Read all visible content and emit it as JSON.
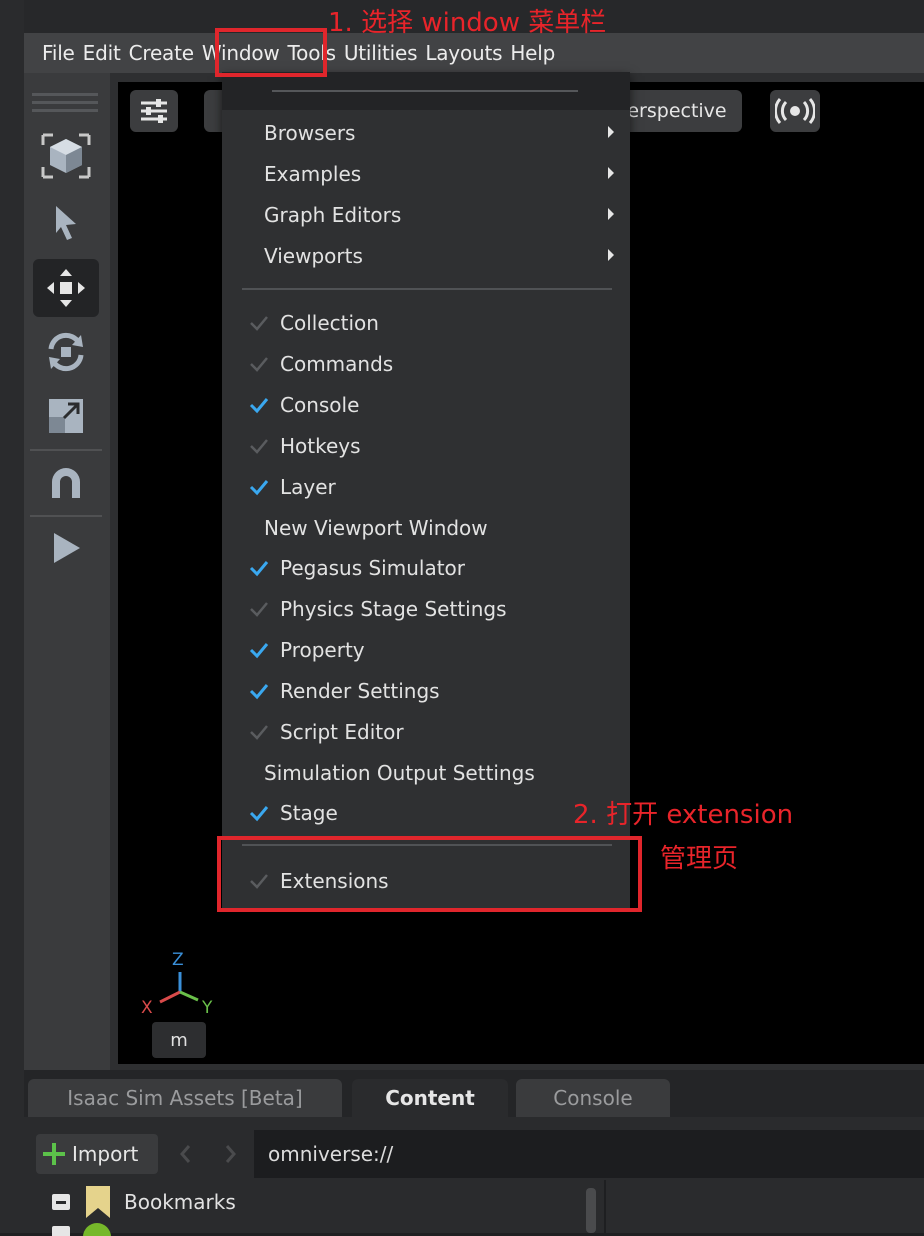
{
  "annotations": {
    "step1": "1. 选择 window 菜单栏",
    "step2_line1": "2. 打开 extension",
    "step2_line2": "管理页"
  },
  "menubar": {
    "items": [
      "File",
      "Edit",
      "Create",
      "Window",
      "Tools",
      "Utilities",
      "Layouts",
      "Help"
    ]
  },
  "viewport": {
    "camera_label": "Perspective",
    "camera_label_visible": "erspective",
    "axes": {
      "z": "Z",
      "x": "X",
      "y": "Y"
    },
    "unit": "m"
  },
  "window_menu": {
    "submenus": [
      "Browsers",
      "Examples",
      "Graph Editors",
      "Viewports"
    ],
    "items": [
      {
        "label": "Collection",
        "checked": false
      },
      {
        "label": "Commands",
        "checked": false
      },
      {
        "label": "Console",
        "checked": true
      },
      {
        "label": "Hotkeys",
        "checked": false
      },
      {
        "label": "Layer",
        "checked": true
      },
      {
        "label": "New Viewport Window",
        "checked": null
      },
      {
        "label": "Pegasus Simulator",
        "checked": true
      },
      {
        "label": "Physics Stage Settings",
        "checked": false
      },
      {
        "label": "Property",
        "checked": true
      },
      {
        "label": "Render Settings",
        "checked": true
      },
      {
        "label": "Script Editor",
        "checked": false
      },
      {
        "label": "Simulation Output Settings",
        "checked": null
      },
      {
        "label": "Stage",
        "checked": true
      }
    ],
    "extensions": {
      "label": "Extensions",
      "checked": false
    }
  },
  "bottom_panel": {
    "tabs": [
      "Isaac Sim Assets [Beta]",
      "Content",
      "Console"
    ],
    "active_tab": "Content",
    "import_label": "Import",
    "path": "omniverse://",
    "tree": [
      "Bookmarks"
    ]
  },
  "colors": {
    "annotation_red": "#e0262c",
    "check_blue": "#3aa8f0",
    "check_dim": "#5a5c5f"
  }
}
